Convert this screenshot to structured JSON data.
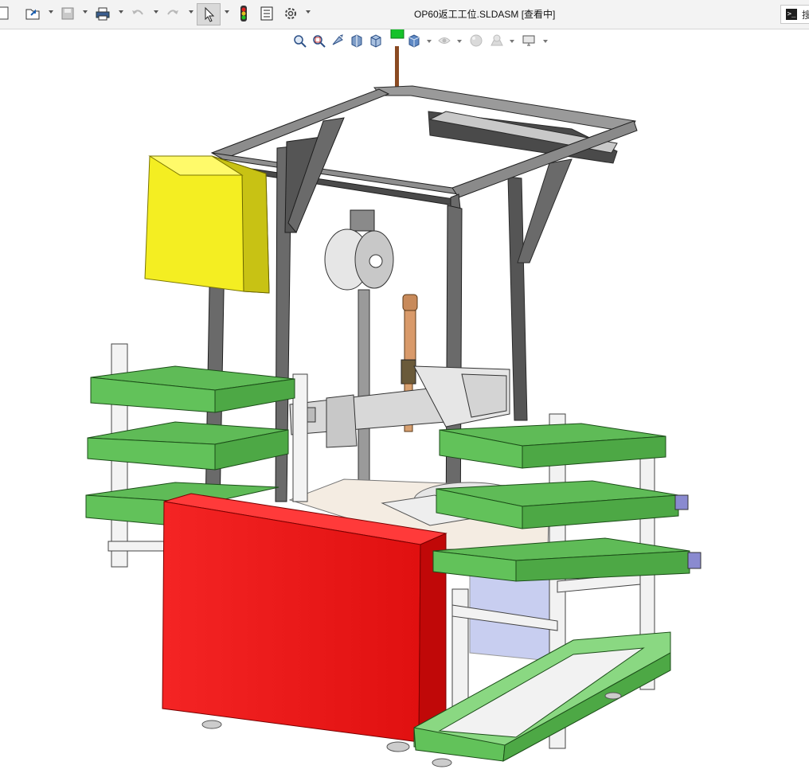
{
  "window": {
    "title": "OP60返工工位.SLDASM [查看中]"
  },
  "search": {
    "label": "搜"
  },
  "toolbar": {
    "items": [
      "new-document",
      "open",
      "save",
      "print",
      "undo",
      "redo",
      "select",
      "rebuild",
      "file-properties",
      "options"
    ]
  },
  "heads_up_toolbar": {
    "items": [
      "zoom-to-fit",
      "zoom-to-area",
      "previous-view",
      "section-view",
      "view-orientation",
      "display-style",
      "hide-show-items",
      "edit-appearance",
      "apply-scene",
      "view-settings"
    ]
  },
  "colors": {
    "toolbar_bg": "#f3f3f3",
    "frame": "#3a3a3a",
    "tray_green": "#66c060",
    "electrical_box": "#f5ee2e",
    "cabinet_red": "#f02020",
    "rack_white": "#f2f2f2",
    "axis_green": "#1fcf2f"
  }
}
